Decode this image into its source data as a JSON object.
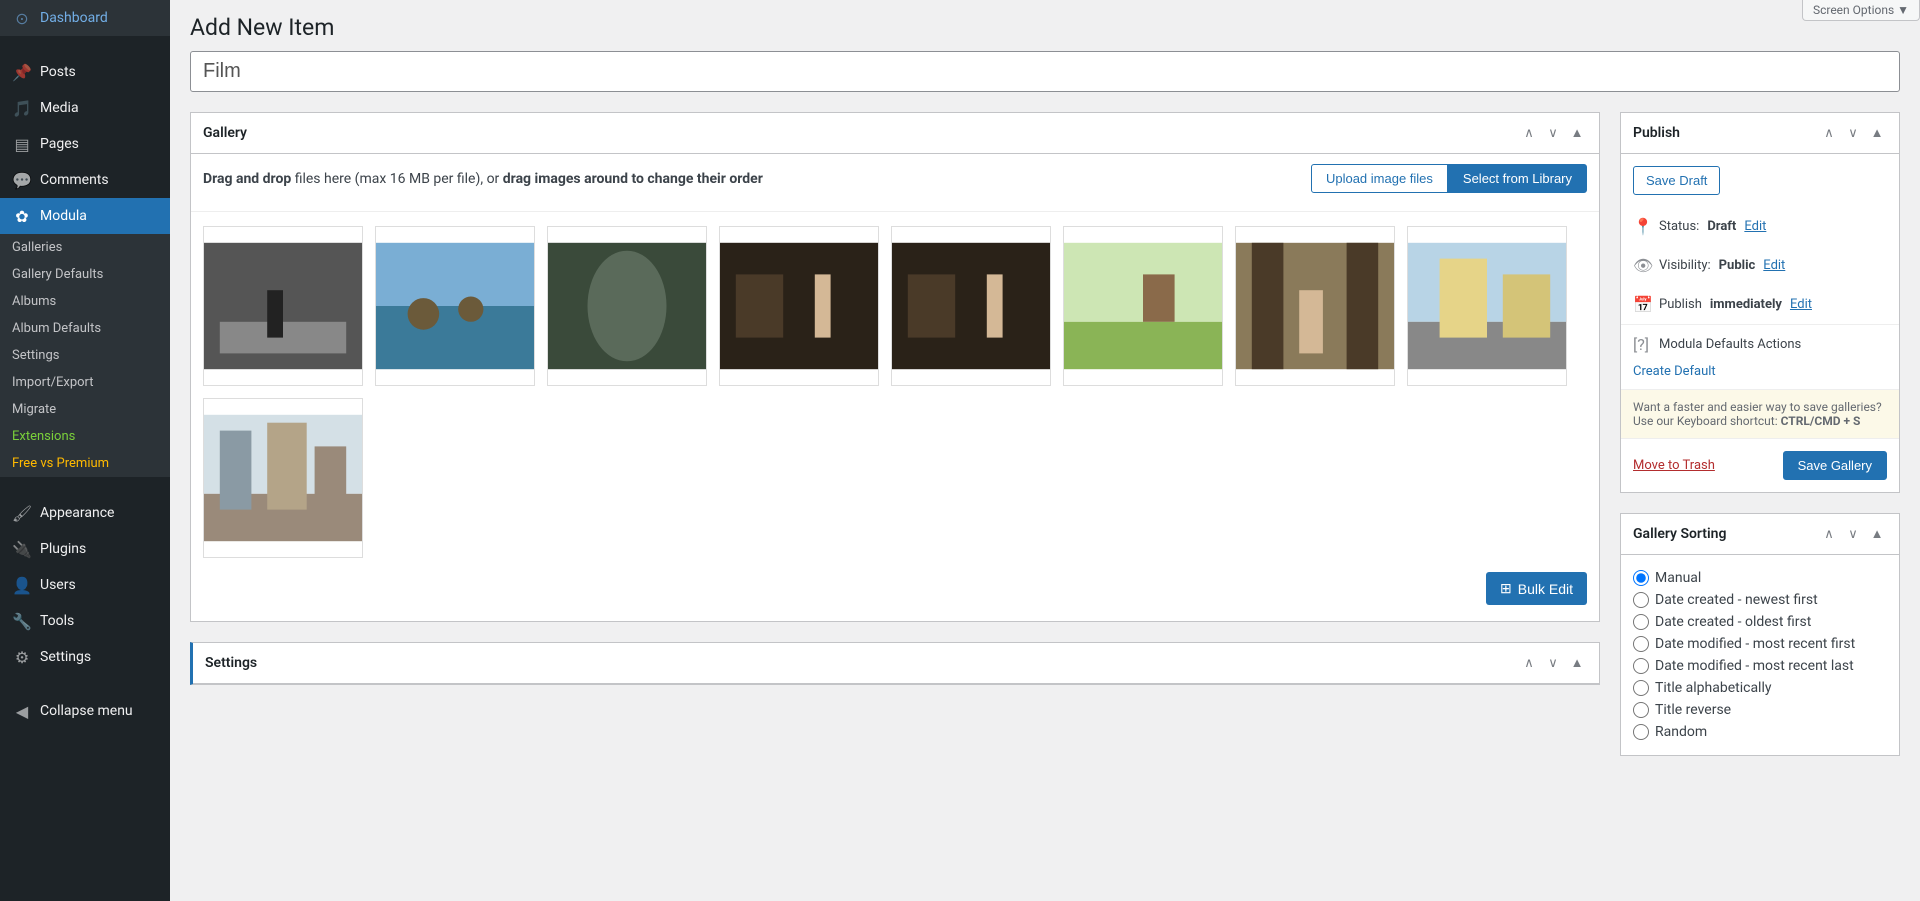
{
  "screenOptions": "Screen Options ▼",
  "pageTitle": "Add New Item",
  "titleInput": "Film",
  "sidebar": {
    "items": [
      {
        "icon": "dashboard",
        "label": "Dashboard"
      },
      {
        "icon": "pin",
        "label": "Posts"
      },
      {
        "icon": "media",
        "label": "Media"
      },
      {
        "icon": "pages",
        "label": "Pages"
      },
      {
        "icon": "comments",
        "label": "Comments"
      },
      {
        "icon": "modula",
        "label": "Modula",
        "active": true
      },
      {
        "icon": "appearance",
        "label": "Appearance"
      },
      {
        "icon": "plugins",
        "label": "Plugins"
      },
      {
        "icon": "users",
        "label": "Users"
      },
      {
        "icon": "tools",
        "label": "Tools"
      },
      {
        "icon": "settings",
        "label": "Settings"
      },
      {
        "icon": "collapse",
        "label": "Collapse menu"
      }
    ],
    "submenu": [
      "Galleries",
      "Gallery Defaults",
      "Albums",
      "Album Defaults",
      "Settings",
      "Import/Export",
      "Migrate",
      "Extensions",
      "Free vs Premium"
    ]
  },
  "gallery": {
    "title": "Gallery",
    "dropPrefix": "Drag and drop",
    "dropMiddle": " files here (max 16 MB per file), or ",
    "dropSuffix": "drag images around to change their order",
    "uploadBtn": "Upload image files",
    "libraryBtn": "Select from Library",
    "bulkEdit": "Bulk Edit",
    "thumbCount": 9
  },
  "settingsBox": {
    "title": "Settings"
  },
  "publish": {
    "title": "Publish",
    "saveDraft": "Save Draft",
    "statusLabel": "Status:",
    "statusValue": "Draft",
    "visibilityLabel": "Visibility:",
    "visibilityValue": "Public",
    "publishLabel": "Publish",
    "publishValue": "immediately",
    "edit": "Edit",
    "defaultsLabel": "Modula Defaults Actions",
    "createDefault": "Create Default",
    "hint1": "Want a faster and easier way to save galleries? Use our Keyboard shortcut: ",
    "hint2": "CTRL/CMD + S",
    "trash": "Move to Trash",
    "saveGallery": "Save Gallery"
  },
  "sorting": {
    "title": "Gallery Sorting",
    "options": [
      "Manual",
      "Date created - newest first",
      "Date created - oldest first",
      "Date modified - most recent first",
      "Date modified - most recent last",
      "Title alphabetically",
      "Title reverse",
      "Random"
    ],
    "selected": 0
  }
}
